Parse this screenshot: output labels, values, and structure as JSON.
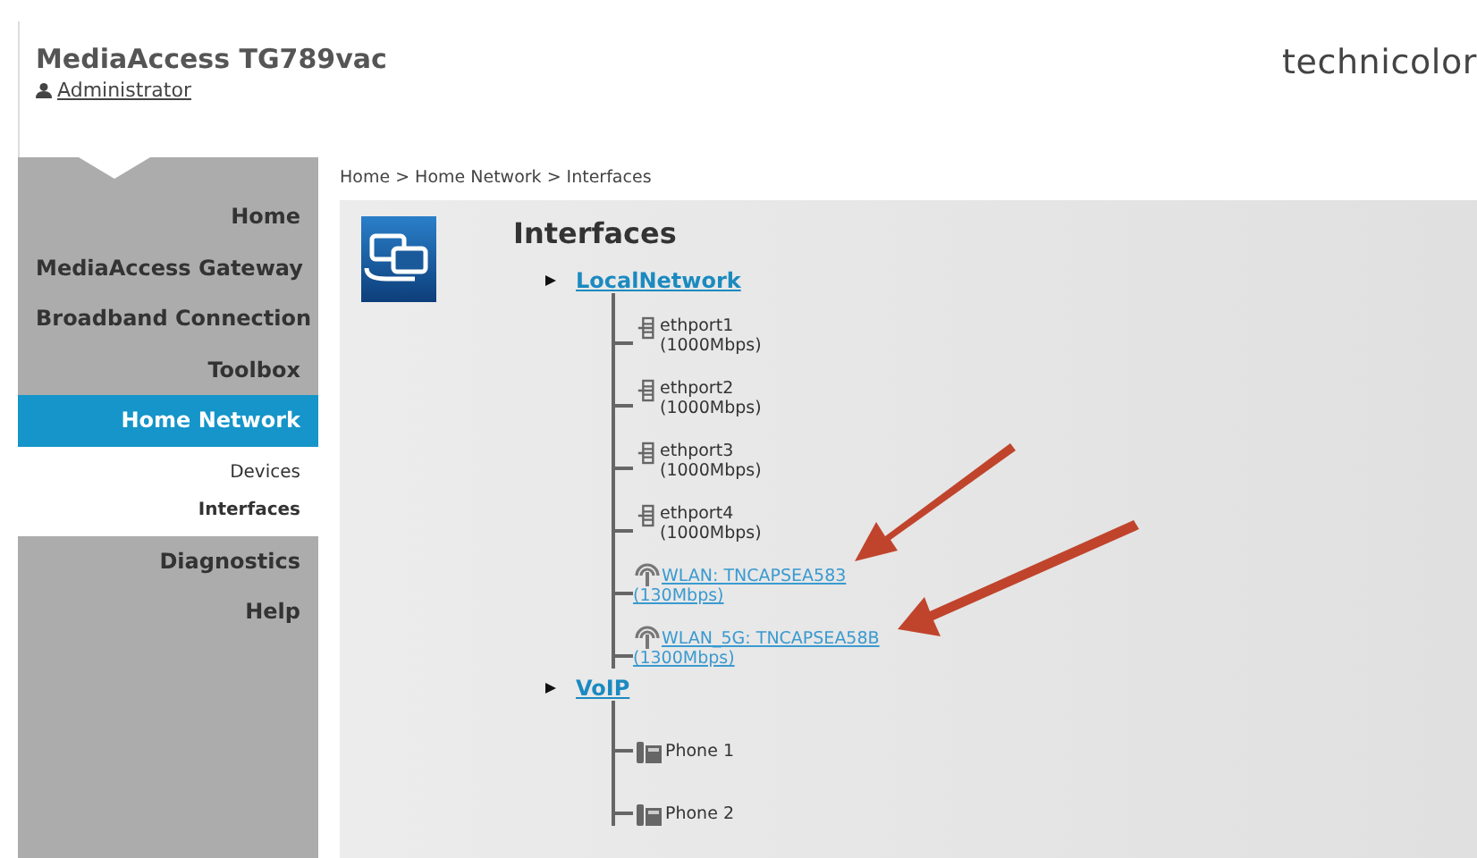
{
  "header": {
    "title": "MediaAccess TG789vac",
    "user": "Administrator",
    "brand": "technicolor"
  },
  "sidebar": {
    "items": [
      {
        "label": "Home",
        "selected": false
      },
      {
        "label": "MediaAccess Gateway",
        "selected": false
      },
      {
        "label": "Broadband Connection",
        "selected": false
      },
      {
        "label": "Toolbox",
        "selected": false
      },
      {
        "label": "Home Network",
        "selected": true,
        "children": [
          {
            "label": "Devices",
            "selected": false
          },
          {
            "label": "Interfaces",
            "selected": true
          }
        ]
      },
      {
        "label": "Diagnostics",
        "selected": false
      },
      {
        "label": "Help",
        "selected": false
      }
    ]
  },
  "breadcrumb": "Home > Home Network > Interfaces",
  "page_title": "Interfaces",
  "tree": [
    {
      "label": "LocalNetwork",
      "children": [
        {
          "kind": "ethernet",
          "name": "ethport1",
          "speed": "(1000Mbps)"
        },
        {
          "kind": "ethernet",
          "name": "ethport2",
          "speed": "(1000Mbps)"
        },
        {
          "kind": "ethernet",
          "name": "ethport3",
          "speed": "(1000Mbps)"
        },
        {
          "kind": "ethernet",
          "name": "ethport4",
          "speed": "(1000Mbps)"
        },
        {
          "kind": "wifi",
          "name": "WLAN: TNCAPSEA583",
          "speed": "(130Mbps)"
        },
        {
          "kind": "wifi",
          "name": "WLAN_5G: TNCAPSEA58B",
          "speed": "(1300Mbps)"
        }
      ]
    },
    {
      "label": "VoIP",
      "children": [
        {
          "kind": "phone",
          "name": "Phone 1"
        },
        {
          "kind": "phone",
          "name": "Phone 2"
        }
      ]
    }
  ]
}
